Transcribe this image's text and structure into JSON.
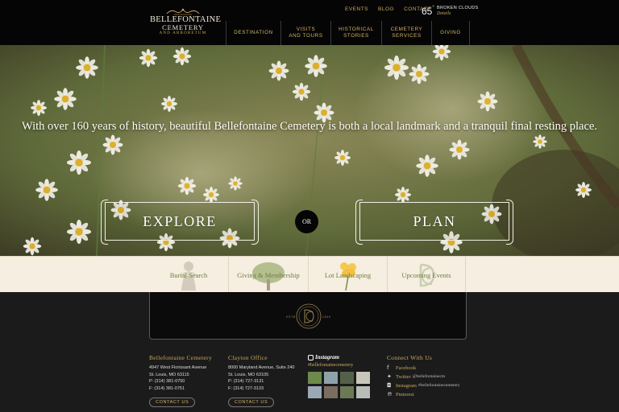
{
  "logo": {
    "line1": "BELLEFONTAINE",
    "line2": "CEMETERY",
    "line3": "AND ARBORETUM"
  },
  "top_links": [
    "EVENTS",
    "BLOG",
    "CONTACT"
  ],
  "weather": {
    "temp": "65",
    "degree": "°",
    "condition": "BROKEN CLOUDS",
    "details": "Details"
  },
  "main_nav": [
    {
      "label": "DESTINATION"
    },
    {
      "label": "VISITS\nAND TOURS"
    },
    {
      "label": "HISTORICAL\nSTORIES"
    },
    {
      "label": "CEMETERY\nSERVICES"
    },
    {
      "label": "GIVING"
    }
  ],
  "hero": {
    "headline": "With over 160 years of history, beautiful Bellefontaine Cemetery is both a local landmark and a tranquil final resting place.",
    "explore_label": "EXPLORE",
    "or_label": "OR",
    "plan_label": "PLAN"
  },
  "quick_links": [
    {
      "label": "Burial Search",
      "icon": "angel-statue-icon"
    },
    {
      "label": "Giving & Membership",
      "icon": "tree-icon"
    },
    {
      "label": "Lot Landscaping",
      "icon": "flower-icon"
    },
    {
      "label": "Upcoming Events",
      "icon": "monogram-icon"
    }
  ],
  "seal": {
    "left": "ESTB",
    "right": "1849"
  },
  "footer": {
    "col1": {
      "title": "Bellefontaine Cemetery",
      "lines": [
        "4947 West Florissant Avenue",
        "St. Louis, MO 63115",
        "P: (314) 381-0750",
        "F: (314) 381-0751"
      ],
      "button": "CONTACT US"
    },
    "col2": {
      "title": "Clayton Office",
      "lines": [
        "8000 Maryland Avenue, Suite 240",
        "St. Louis, MO 63105",
        "P: (314) 727-3131",
        "F: (314) 727-3133"
      ],
      "button": "CONTACT US"
    },
    "instagram": {
      "title": "Instagram",
      "hashtag": "#bellefontainecemetery"
    },
    "connect": {
      "title": "Connect With Us",
      "facebook": "Facebook",
      "twitter": "Twitter",
      "twitter_handle": "@bellefontainecm",
      "instagram": "Instagram",
      "instagram_handle": "#bellefontainecemetery",
      "pinterest": "Pinterest"
    }
  },
  "colors": {
    "gold": "#c9a85f",
    "olive": "#6f7c3c",
    "cream": "#f5eee1",
    "black": "#050505"
  }
}
